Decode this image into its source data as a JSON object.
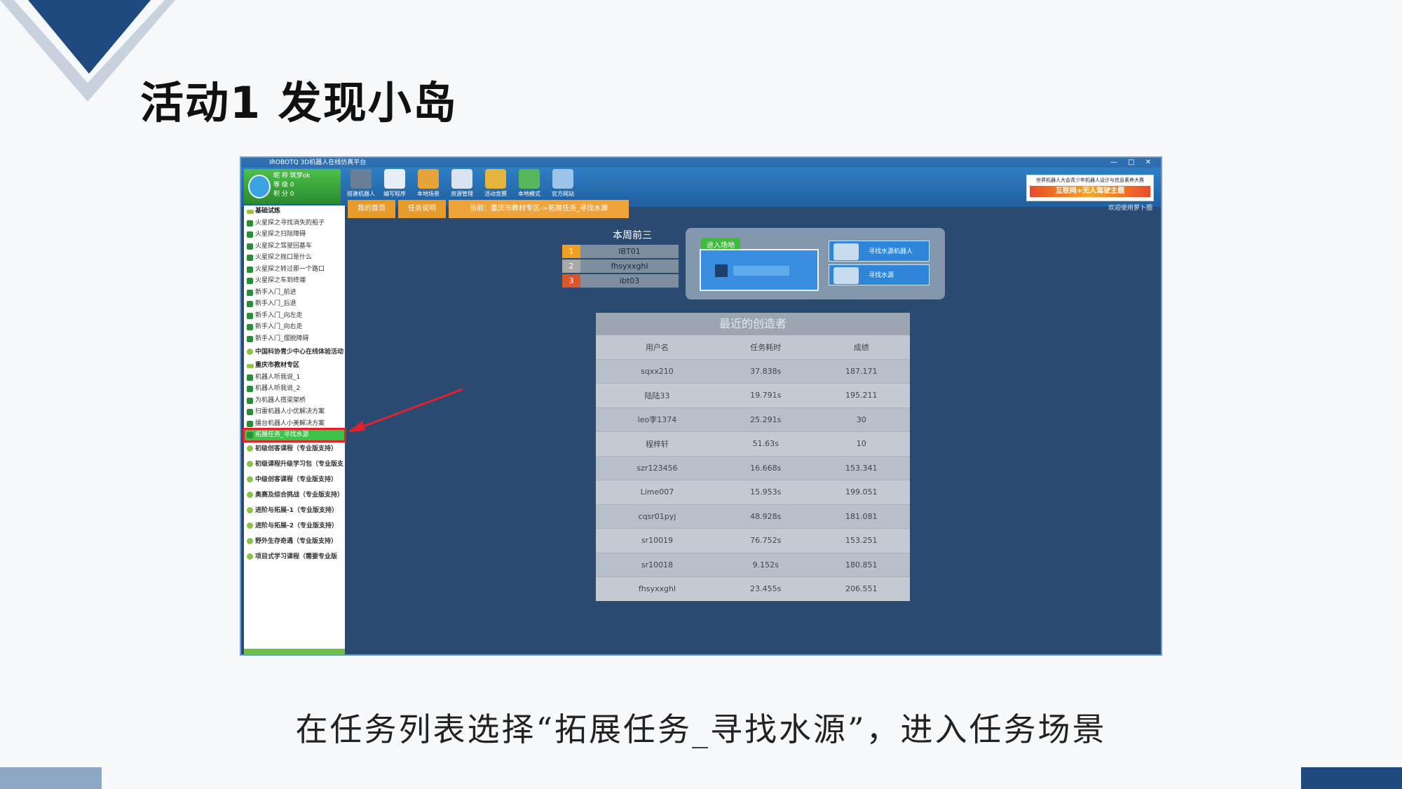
{
  "slide": {
    "title": "活动1  发现小岛",
    "caption": "在任务列表选择“拓展任务_寻找水源”，进入任务场景",
    "colors": {
      "accent_dark": "#1f4a80",
      "accent_light": "#8ea7c4"
    }
  },
  "app": {
    "window_title": "IROBOTQ 3D机器人在线仿真平台",
    "window_controls": "— □ ✕",
    "user": {
      "rows": [
        "昵 称  筑梦ok",
        "等 级  0",
        "积 分  0"
      ]
    },
    "toolbar": [
      {
        "label": "搭建机器人",
        "icon": "wrench-icon",
        "color": "#6a7f96"
      },
      {
        "label": "编写程序",
        "icon": "notepad-icon",
        "color": "#e8eef5"
      },
      {
        "label": "本地场景",
        "icon": "tent-icon",
        "color": "#e8a23a"
      },
      {
        "label": "资源管理",
        "icon": "books-icon",
        "color": "#d9e4f0"
      },
      {
        "label": "活动竞赛",
        "icon": "medal-icon",
        "color": "#e5b43c"
      },
      {
        "label": "本地模式",
        "icon": "globe-icon",
        "color": "#56b85a"
      },
      {
        "label": "官方网站",
        "icon": "monitor-icon",
        "color": "#9cc3e8"
      }
    ],
    "banner": {
      "top": "世界机器人大会青少年机器人设计与信息素养大赛",
      "main": "互联网+无人驾驶主题"
    },
    "welcome": "欢迎使用萝卜圈",
    "sidebar": {
      "items": [
        {
          "label": "基础试炼",
          "kind": "group"
        },
        {
          "label": "火星探之寻找消失的船子",
          "kind": "item"
        },
        {
          "label": "火星探之扫除障碍",
          "kind": "item"
        },
        {
          "label": "火星探之驾驶回基车",
          "kind": "item"
        },
        {
          "label": "火星探之抛口是什么",
          "kind": "item"
        },
        {
          "label": "火星探之转过那一个路口",
          "kind": "item"
        },
        {
          "label": "火星探之车到终端",
          "kind": "item"
        },
        {
          "label": "新手入门_前进",
          "kind": "item"
        },
        {
          "label": "新手入门_后退",
          "kind": "item"
        },
        {
          "label": "新手入门_向左走",
          "kind": "item"
        },
        {
          "label": "新手入门_向右走",
          "kind": "item"
        },
        {
          "label": "新手入门_摆脱障碍",
          "kind": "item"
        },
        {
          "label": "中国科协青少中心在线体验活动",
          "kind": "cat"
        },
        {
          "label": "重庆市教材专区",
          "kind": "group"
        },
        {
          "label": "机器人听我说_1",
          "kind": "item"
        },
        {
          "label": "机器人听我说_2",
          "kind": "item"
        },
        {
          "label": "为机器人搭梁架桥",
          "kind": "item"
        },
        {
          "label": "扫雷机器人小优解决方案",
          "kind": "item"
        },
        {
          "label": "擂台机器人小美解决方案",
          "kind": "item"
        },
        {
          "label": "拓展任务_寻找水源",
          "kind": "selected"
        },
        {
          "label": "初级创客课程（专业版支持）",
          "kind": "cat"
        },
        {
          "label": "初级课程升级学习包（专业版支",
          "kind": "cat"
        },
        {
          "label": "中级创客课程（专业版支持）",
          "kind": "cat"
        },
        {
          "label": "奥赛及综合挑战（专业版支持）",
          "kind": "cat"
        },
        {
          "label": "进阶与拓展-1（专业版支持）",
          "kind": "cat"
        },
        {
          "label": "进阶与拓展-2（专业版支持）",
          "kind": "cat"
        },
        {
          "label": "野外生存奇遇（专业版支持）",
          "kind": "cat"
        },
        {
          "label": "项目式学习课程（需要专业版",
          "kind": "cat"
        }
      ]
    },
    "tabs": [
      "我的首页",
      "任务说明",
      "当前：重庆市教材专区->拓展任务_寻找水源"
    ],
    "ranking": {
      "title": "本周前三",
      "rows": [
        {
          "rank": "1",
          "name": "IBT01",
          "color": "#f0a020"
        },
        {
          "rank": "2",
          "name": "fhsyxxghl",
          "color": "#a8a8a8"
        },
        {
          "rank": "3",
          "name": "ibt03",
          "color": "#d9572b"
        }
      ]
    },
    "enter": {
      "label": "进入场地",
      "choices": [
        "寻找水源机器人",
        "寻找水源"
      ]
    },
    "creators": {
      "title": "最近的创造者",
      "headers": [
        "用户名",
        "任务耗时",
        "成绩"
      ],
      "rows": [
        [
          "sqxx210",
          "37.838s",
          "187.171"
        ],
        [
          "陆陆33",
          "19.791s",
          "195.211"
        ],
        [
          "leo李1374",
          "25.291s",
          "30"
        ],
        [
          "程梓轩",
          "51.63s",
          "10"
        ],
        [
          "szr123456",
          "16.668s",
          "153.341"
        ],
        [
          "Lime007",
          "15.953s",
          "199.051"
        ],
        [
          "cqsr01pyj",
          "48.928s",
          "181.081"
        ],
        [
          "sr10019",
          "76.752s",
          "153.251"
        ],
        [
          "sr10018",
          "9.152s",
          "180.851"
        ],
        [
          "fhsyxxghl",
          "23.455s",
          "206.551"
        ]
      ]
    }
  }
}
